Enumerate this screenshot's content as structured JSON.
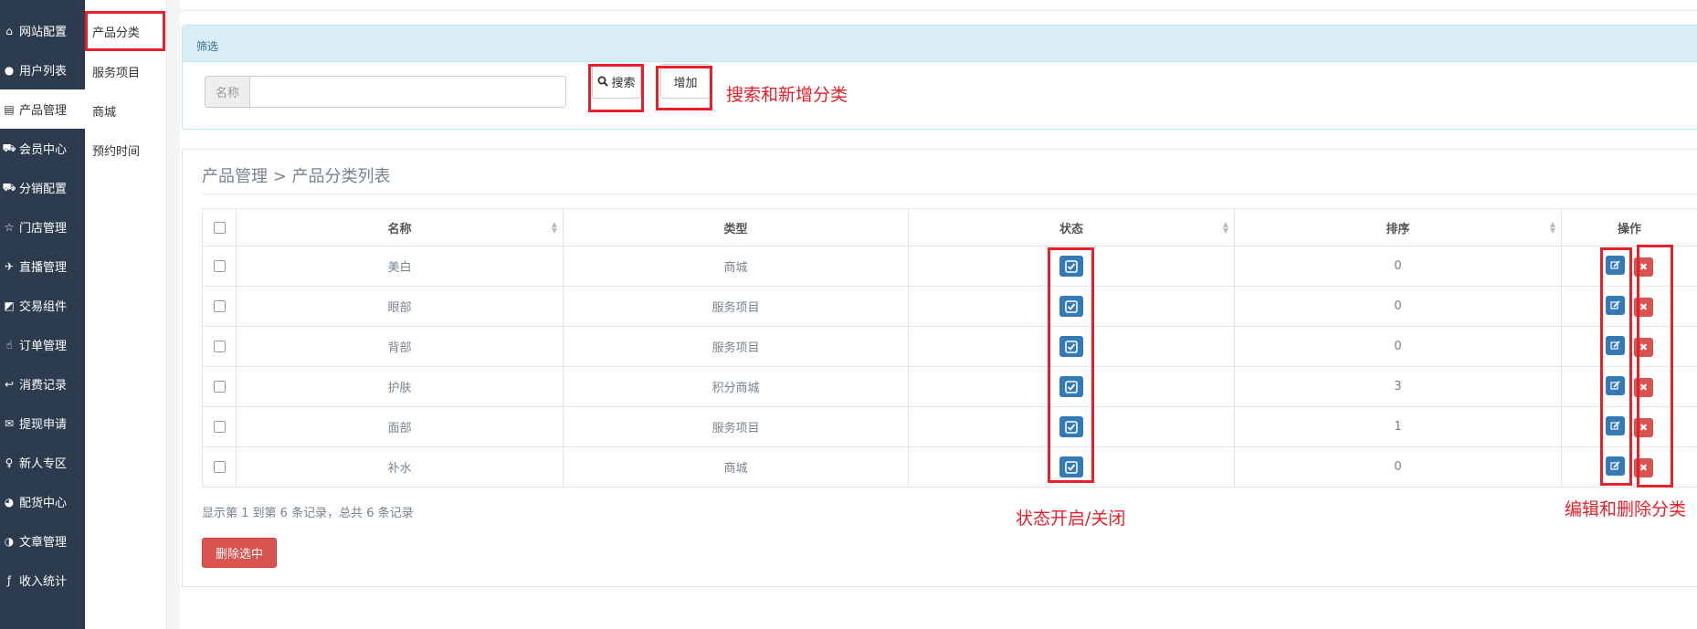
{
  "sidebar": {
    "items": [
      {
        "label": "网站配置",
        "icon": "home-icon",
        "glyph": "⌂"
      },
      {
        "label": "用户列表",
        "icon": "user-icon",
        "glyph": "●"
      },
      {
        "label": "产品管理",
        "icon": "server-icon",
        "glyph": "▤"
      },
      {
        "label": "会员中心",
        "icon": "cart-icon",
        "glyph": "⛟"
      },
      {
        "label": "分销配置",
        "icon": "cart-icon",
        "glyph": "⛟"
      },
      {
        "label": "门店管理",
        "icon": "star-icon",
        "glyph": "☆"
      },
      {
        "label": "直播管理",
        "icon": "plane-icon",
        "glyph": "✈"
      },
      {
        "label": "交易组件",
        "icon": "eraser-icon",
        "glyph": "◩"
      },
      {
        "label": "订单管理",
        "icon": "thumbs-up-icon",
        "glyph": "☝"
      },
      {
        "label": "消费记录",
        "icon": "reply-icon",
        "glyph": "↩"
      },
      {
        "label": "提现申请",
        "icon": "comments-icon",
        "glyph": "✉"
      },
      {
        "label": "新人专区",
        "icon": "map-pin-icon",
        "glyph": "♀"
      },
      {
        "label": "配货中心",
        "icon": "pie-chart-icon",
        "glyph": "◕"
      },
      {
        "label": "文章管理",
        "icon": "adjust-icon",
        "glyph": "◑"
      },
      {
        "label": "收入统计",
        "icon": "fork-icon",
        "glyph": "ƒ"
      }
    ],
    "active_index": 2
  },
  "submenu": {
    "items": [
      "产品分类",
      "服务项目",
      "商城",
      "预约时间"
    ]
  },
  "filter": {
    "title": "筛选",
    "name_label": "名称",
    "name_value": "",
    "search_label": "搜索",
    "add_label": "增加"
  },
  "list": {
    "breadcrumb": "产品管理 > 产品分类列表",
    "columns": [
      "名称",
      "类型",
      "状态",
      "排序",
      "操作"
    ],
    "rows": [
      {
        "name": "美白",
        "type": "商城",
        "sort": "0"
      },
      {
        "name": "眼部",
        "type": "服务项目",
        "sort": "0"
      },
      {
        "name": "背部",
        "type": "服务项目",
        "sort": "0"
      },
      {
        "name": "护肤",
        "type": "积分商城",
        "sort": "3"
      },
      {
        "name": "面部",
        "type": "服务项目",
        "sort": "1"
      },
      {
        "name": "补水",
        "type": "商城",
        "sort": "0"
      }
    ],
    "records_text": "显示第 1 到第 6 条记录，总共 6 条记录",
    "delete_selected_label": "删除选中"
  },
  "annotations": {
    "search_add": "搜索和新增分类",
    "status_toggle": "状态开启/关闭",
    "edit_delete": "编辑和删除分类"
  },
  "colors": {
    "sidebar_bg": "#2c3b4e",
    "primary": "#337ab7",
    "danger": "#d9534f",
    "annotation_red": "#e8202a",
    "filter_head_bg": "#d9edf7"
  }
}
